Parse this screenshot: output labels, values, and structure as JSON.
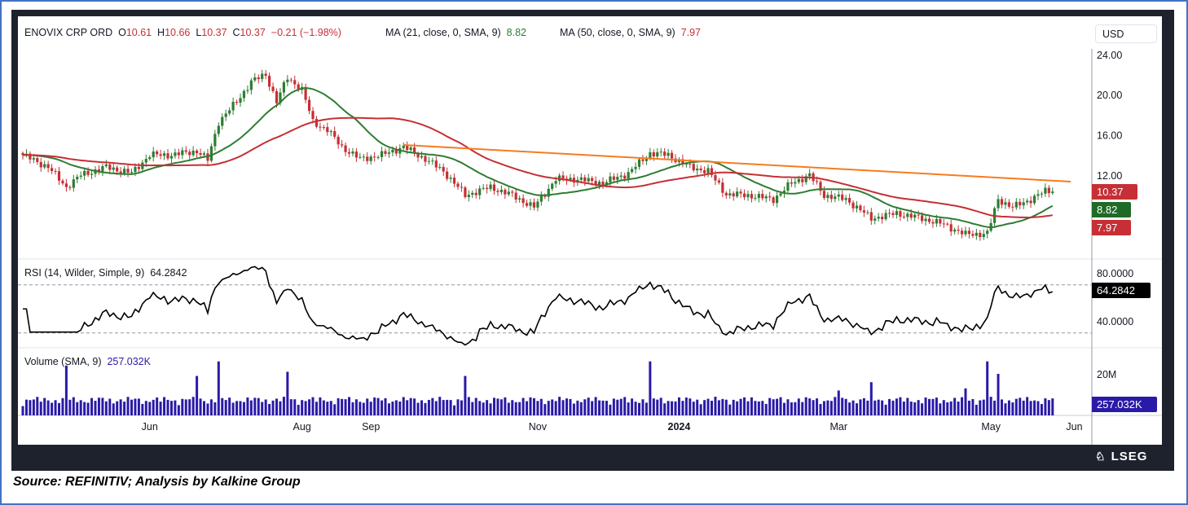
{
  "header": {
    "symbol": "ENOVIX CRP ORD",
    "open_label": "O",
    "open": "10.61",
    "high_label": "H",
    "high": "10.66",
    "low_label": "L",
    "low": "10.37",
    "close_label": "C",
    "close": "10.37",
    "change": "−0.21 (−1.98%)",
    "ma21_label": "MA (21, close, 0, SMA, 9)",
    "ma21_value": "8.82",
    "ma50_label": "MA (50, close, 0, SMA, 9)",
    "ma50_value": "7.97"
  },
  "currency_button": "USD",
  "rsi_header": {
    "label": "RSI (14, Wilder, Simple, 9)",
    "value": "64.2842"
  },
  "volume_header": {
    "label": "Volume (SMA, 9)",
    "value": "257.032K"
  },
  "tags": {
    "price": "10.37",
    "ma21": "8.82",
    "ma50": "7.97",
    "rsi": "64.2842",
    "volume": "257.032K"
  },
  "colors": {
    "up": "#26a69a",
    "down": "#ef5350",
    "candle": "#2e7d32",
    "candle_down": "#c62f35",
    "ma21": "#2e7d32",
    "ma50": "#c62f35",
    "trend": "#f57c20",
    "rsi": "#000000",
    "volume": "#2a1aa8",
    "price_tag": "#c62f35",
    "ma21_tag": "#1f6b26",
    "ma50_tag": "#c62f35",
    "rsi_tag": "#000000",
    "volume_tag": "#2a1aa8"
  },
  "logo": "LSEG",
  "source": "Source: REFINITIV; Analysis by Kalkine Group",
  "chart_data": {
    "type": "candlestick",
    "title": "ENOVIX CRP ORD",
    "bars": 285,
    "price_axis": {
      "ticks": [
        "24.00",
        "20.00",
        "16.00",
        "12.00"
      ],
      "tick_values": [
        24,
        20,
        16,
        12
      ],
      "range": [
        5,
        25
      ]
    },
    "close_anchors": [
      [
        0,
        14.0
      ],
      [
        7,
        12.8
      ],
      [
        12,
        10.8
      ],
      [
        16,
        12.0
      ],
      [
        23,
        12.8
      ],
      [
        30,
        12.2
      ],
      [
        35,
        14.0
      ],
      [
        41,
        14.0
      ],
      [
        48,
        14.4
      ],
      [
        51,
        13.5
      ],
      [
        54,
        17.3
      ],
      [
        59,
        19.3
      ],
      [
        63,
        21.3
      ],
      [
        67,
        22.0
      ],
      [
        70,
        19.3
      ],
      [
        73,
        21.7
      ],
      [
        77,
        20.5
      ],
      [
        80,
        17.3
      ],
      [
        84,
        16.5
      ],
      [
        88,
        14.8
      ],
      [
        93,
        13.6
      ],
      [
        99,
        14.0
      ],
      [
        105,
        14.8
      ],
      [
        111,
        13.6
      ],
      [
        116,
        12.4
      ],
      [
        122,
        10.0
      ],
      [
        129,
        10.8
      ],
      [
        135,
        10.0
      ],
      [
        141,
        8.8
      ],
      [
        147,
        11.6
      ],
      [
        153,
        11.6
      ],
      [
        160,
        11.2
      ],
      [
        167,
        12.2
      ],
      [
        173,
        14.2
      ],
      [
        178,
        14.0
      ],
      [
        184,
        12.8
      ],
      [
        189,
        12.4
      ],
      [
        194,
        10.1
      ],
      [
        200,
        10.0
      ],
      [
        207,
        9.6
      ],
      [
        212,
        11.2
      ],
      [
        217,
        12.0
      ],
      [
        221,
        10.0
      ],
      [
        227,
        9.6
      ],
      [
        234,
        7.7
      ],
      [
        241,
        8.2
      ],
      [
        248,
        7.7
      ],
      [
        254,
        7.1
      ],
      [
        260,
        6.1
      ],
      [
        266,
        6.2
      ],
      [
        269,
        9.6
      ],
      [
        273,
        8.8
      ],
      [
        278,
        9.6
      ],
      [
        282,
        10.4
      ],
      [
        284,
        10.37
      ]
    ],
    "moving_averages": [
      {
        "name": "MA 21",
        "period": 21,
        "last": 8.82
      },
      {
        "name": "MA 50",
        "period": 50,
        "last": 7.97
      }
    ],
    "trendline": {
      "start": [
        105,
        15.0
      ],
      "end": [
        289,
        11.35
      ]
    },
    "rsi": {
      "period": 14,
      "range": [
        20,
        90
      ],
      "ticks": [
        "80.0000",
        "40.0000"
      ],
      "tick_values": [
        80,
        40
      ],
      "bands": [
        70,
        30
      ],
      "last": 64.2842
    },
    "volume": {
      "unit": "M",
      "ticks": [
        "20M"
      ],
      "tick_values": [
        20
      ],
      "range": [
        0,
        30
      ],
      "base": 4.5,
      "spikes": [
        [
          12,
          24
        ],
        [
          48,
          19
        ],
        [
          54,
          26
        ],
        [
          73,
          21
        ],
        [
          122,
          19
        ],
        [
          173,
          26
        ],
        [
          266,
          26
        ],
        [
          269,
          20
        ],
        [
          234,
          16
        ],
        [
          260,
          13
        ],
        [
          225,
          12
        ]
      ]
    },
    "time_axis": [
      {
        "label": "Jun",
        "index": 35
      },
      {
        "label": "Aug",
        "index": 77
      },
      {
        "label": "Sep",
        "index": 96
      },
      {
        "label": "Nov",
        "index": 142
      },
      {
        "label": "2024",
        "index": 181,
        "bold": true
      },
      {
        "label": "Mar",
        "index": 225
      },
      {
        "label": "May",
        "index": 267
      },
      {
        "label": "Jun",
        "index": 290
      }
    ]
  }
}
